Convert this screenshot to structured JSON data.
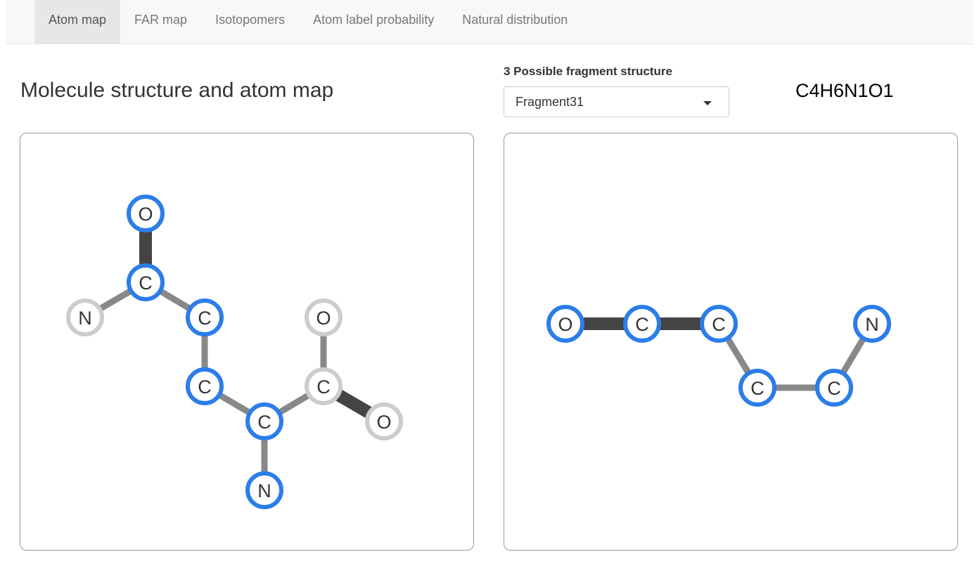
{
  "tabs": [
    {
      "label": "Atom map",
      "active": true
    },
    {
      "label": "FAR map",
      "active": false
    },
    {
      "label": "Isotopomers",
      "active": false
    },
    {
      "label": "Atom label probability",
      "active": false
    },
    {
      "label": "Natural distribution",
      "active": false
    }
  ],
  "main": {
    "title": "Molecule structure and atom map"
  },
  "fragment_select": {
    "label": "3 Possible fragment structure",
    "value": "Fragment31"
  },
  "formula": "C4H6N1O1",
  "colors": {
    "mapped_atom": "#2b7de9",
    "unmapped_atom": "#cccccc",
    "single_bond": "#888888",
    "double_bond": "#444444"
  },
  "molecule": {
    "atoms": [
      {
        "id": "o1",
        "label": "O",
        "mapped": true
      },
      {
        "id": "c1",
        "label": "C",
        "mapped": true
      },
      {
        "id": "n1",
        "label": "N",
        "mapped": false
      },
      {
        "id": "c2",
        "label": "C",
        "mapped": true
      },
      {
        "id": "c3",
        "label": "C",
        "mapped": true
      },
      {
        "id": "ca",
        "label": "C",
        "mapped": true
      },
      {
        "id": "n2",
        "label": "N",
        "mapped": true
      },
      {
        "id": "cc",
        "label": "C",
        "mapped": false
      },
      {
        "id": "o2",
        "label": "O",
        "mapped": false
      },
      {
        "id": "o3",
        "label": "O",
        "mapped": false
      }
    ],
    "bonds": [
      {
        "from": "o1",
        "to": "c1",
        "order": 2
      },
      {
        "from": "c1",
        "to": "n1",
        "order": 1
      },
      {
        "from": "c1",
        "to": "c2",
        "order": 1
      },
      {
        "from": "c2",
        "to": "c3",
        "order": 1
      },
      {
        "from": "c3",
        "to": "ca",
        "order": 1
      },
      {
        "from": "ca",
        "to": "n2",
        "order": 1
      },
      {
        "from": "ca",
        "to": "cc",
        "order": 1
      },
      {
        "from": "cc",
        "to": "o2",
        "order": 1
      },
      {
        "from": "cc",
        "to": "o3",
        "order": 2
      }
    ]
  },
  "fragment": {
    "atoms": [
      {
        "id": "fo",
        "label": "O",
        "mapped": true
      },
      {
        "id": "fc1",
        "label": "C",
        "mapped": true
      },
      {
        "id": "fc2",
        "label": "C",
        "mapped": true
      },
      {
        "id": "fc3",
        "label": "C",
        "mapped": true
      },
      {
        "id": "fc4",
        "label": "C",
        "mapped": true
      },
      {
        "id": "fn",
        "label": "N",
        "mapped": true
      }
    ],
    "bonds": [
      {
        "from": "fo",
        "to": "fc1",
        "order": 2
      },
      {
        "from": "fc1",
        "to": "fc2",
        "order": 2
      },
      {
        "from": "fc2",
        "to": "fc3",
        "order": 1
      },
      {
        "from": "fc3",
        "to": "fc4",
        "order": 1
      },
      {
        "from": "fc4",
        "to": "fn",
        "order": 1
      }
    ]
  }
}
